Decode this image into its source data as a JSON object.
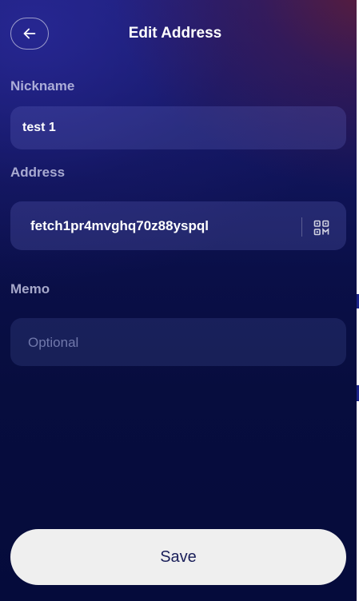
{
  "header": {
    "title": "Edit Address",
    "back_icon": "arrow-left-icon"
  },
  "form": {
    "nickname": {
      "label": "Nickname",
      "value": "test 1"
    },
    "address": {
      "label": "Address",
      "value": "fetch1pr4mvghq70z88yspql",
      "action_icon": "qr-code-icon"
    },
    "memo": {
      "label": "Memo",
      "value": "",
      "placeholder": "Optional"
    }
  },
  "actions": {
    "save_label": "Save"
  },
  "colors": {
    "background_top": "#1e1f7a",
    "background_bottom": "#050b3b",
    "accent_corner": "#601c34",
    "field_background": "#2f3478",
    "save_button": "#efefef",
    "save_text": "#1a1f5a"
  }
}
